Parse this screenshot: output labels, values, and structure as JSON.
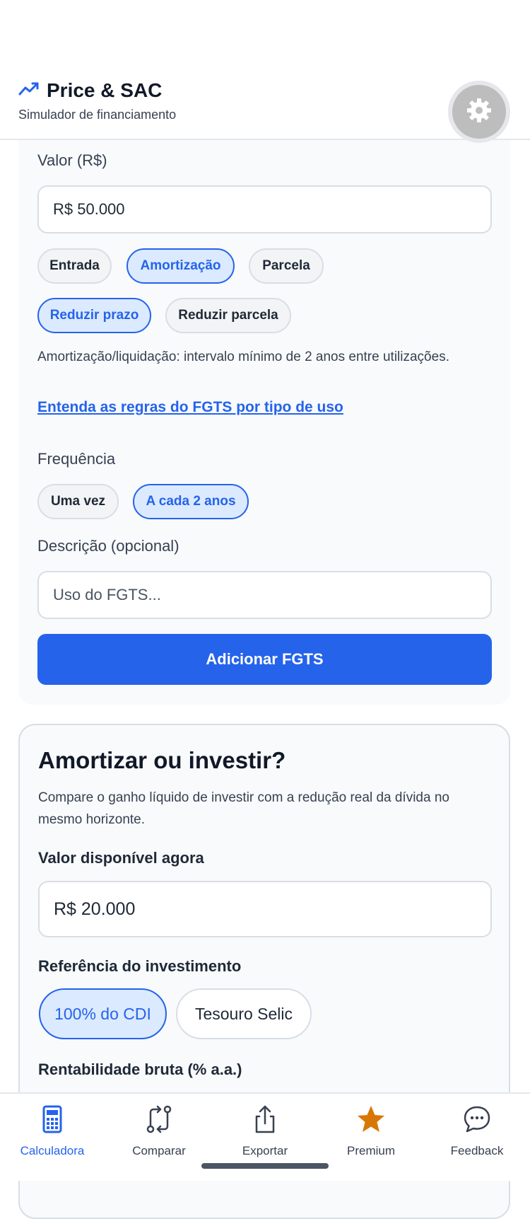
{
  "header": {
    "title": "Price & SAC",
    "subtitle": "Simulador de financiamento",
    "trend_icon": "trend-up-icon",
    "settings_icon": "gear-icon"
  },
  "fgts": {
    "value_label": "Valor (R$)",
    "value_input": "R$ 50.000",
    "type_options": [
      "Entrada",
      "Amortização",
      "Parcela"
    ],
    "type_selected": "Amortização",
    "effect_options": [
      "Reduzir prazo",
      "Reduzir parcela"
    ],
    "effect_selected": "Reduzir prazo",
    "note": "Amortização/liquidação: intervalo mínimo de 2 anos entre utilizações.",
    "rules_link": "Entenda as regras do FGTS por tipo de uso",
    "frequency_label": "Frequência",
    "frequency_options": [
      "Uma vez",
      "A cada 2 anos"
    ],
    "frequency_selected": "A cada 2 anos",
    "description_label": "Descrição (opcional)",
    "description_placeholder": "Uso do FGTS...",
    "add_button": "Adicionar FGTS"
  },
  "invest": {
    "title": "Amortizar ou investir?",
    "description": "Compare o ganho líquido de investir com a redução real da dívida no mesmo horizonte.",
    "available_label": "Valor disponível agora",
    "available_input": "R$ 20.000",
    "reference_label": "Referência do investimento",
    "reference_options": [
      "100% do CDI",
      "Tesouro Selic"
    ],
    "reference_selected": "100% do CDI",
    "yield_label": "Rentabilidade bruta (% a.a.)"
  },
  "nav": {
    "items": [
      {
        "label": "Calculadora",
        "icon": "calculator-icon",
        "active": true
      },
      {
        "label": "Comparar",
        "icon": "compare-icon",
        "active": false
      },
      {
        "label": "Exportar",
        "icon": "share-icon",
        "active": false
      },
      {
        "label": "Premium",
        "icon": "star-icon",
        "active": false
      },
      {
        "label": "Feedback",
        "icon": "chat-bubble-icon",
        "active": false
      }
    ]
  },
  "colors": {
    "accent": "#2563eb",
    "accent_light": "#dbeafe",
    "premium": "#d97706"
  }
}
